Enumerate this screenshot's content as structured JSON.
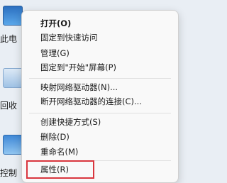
{
  "desktop": {
    "icons": [
      {
        "label": "此电",
        "icon": "computer-icon"
      },
      {
        "label": "回收",
        "icon": "recycle-bin-icon"
      },
      {
        "label": "控制",
        "icon": "control-panel-icon"
      }
    ]
  },
  "context_menu": {
    "items": [
      {
        "label": "打开(O)"
      },
      {
        "label": "固定到快速访问"
      },
      {
        "label": "管理(G)"
      },
      {
        "label": "固定到\"开始\"屏幕(P)"
      },
      {
        "label": "映射网络驱动器(N)..."
      },
      {
        "label": "断开网络驱动器的连接(C)..."
      },
      {
        "label": "创建快捷方式(S)"
      },
      {
        "label": "删除(D)"
      },
      {
        "label": "重命名(M)"
      },
      {
        "label": "属性(R)"
      }
    ],
    "highlight_color": "#d9363e"
  }
}
